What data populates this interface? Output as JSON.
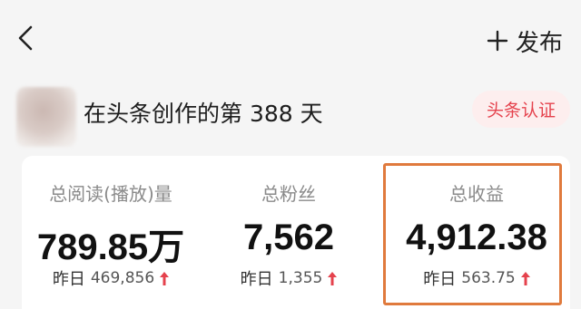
{
  "header": {
    "publish_label": "发布"
  },
  "profile": {
    "days_text": "在头条创作的第 388 天",
    "verify_label": "头条认证"
  },
  "stats": [
    {
      "label": "总阅读(播放)量",
      "value": "789.85万",
      "delta_prefix": "昨日",
      "delta_value": "469,856"
    },
    {
      "label": "总粉丝",
      "value": "7,562",
      "delta_prefix": "昨日",
      "delta_value": "1,355"
    },
    {
      "label": "总收益",
      "value": "4,912.38",
      "delta_prefix": "昨日",
      "delta_value": "563.75"
    }
  ],
  "colors": {
    "accent_red": "#e5424d",
    "highlight_orange": "#e07a3d"
  },
  "icons": {
    "back": "chevron-left-icon",
    "publish": "plus-icon",
    "delta": "arrow-up-icon"
  }
}
